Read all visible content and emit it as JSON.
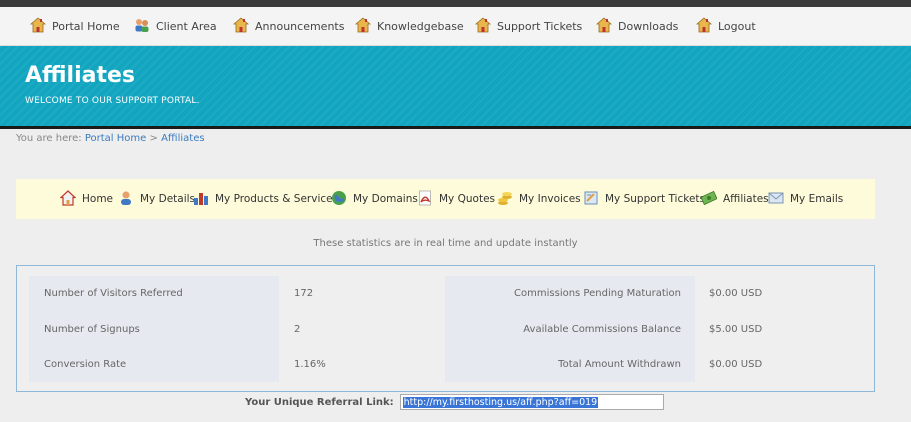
{
  "topnav": [
    {
      "label": "Portal Home",
      "icon": "house-icon"
    },
    {
      "label": "Client Area",
      "icon": "users-icon"
    },
    {
      "label": "Announcements",
      "icon": "house-icon"
    },
    {
      "label": "Knowledgebase",
      "icon": "house-icon"
    },
    {
      "label": "Support Tickets",
      "icon": "house-icon"
    },
    {
      "label": "Downloads",
      "icon": "house-icon"
    },
    {
      "label": "Logout",
      "icon": "house-icon"
    }
  ],
  "banner": {
    "title": "Affiliates",
    "subtitle": "WELCOME TO OUR SUPPORT PORTAL."
  },
  "breadcrumb": {
    "prefix": "You are here:",
    "home": "Portal Home",
    "separator": ">",
    "current": "Affiliates"
  },
  "menu": [
    {
      "label": "Home",
      "icon": "home-icon"
    },
    {
      "label": "My Details",
      "icon": "person-icon"
    },
    {
      "label": "My Products & Services",
      "icon": "bar-chart-icon"
    },
    {
      "label": "My Domains",
      "icon": "globe-icon"
    },
    {
      "label": "My Quotes",
      "icon": "pdf-icon"
    },
    {
      "label": "My Invoices",
      "icon": "coins-icon"
    },
    {
      "label": "My Support Tickets",
      "icon": "ticket-icon"
    },
    {
      "label": "Affiliates",
      "icon": "money-icon"
    },
    {
      "label": "My Emails",
      "icon": "envelope-icon"
    }
  ],
  "notice": "These statistics are in real time and update instantly",
  "stats": {
    "left": [
      {
        "label": "Number of Visitors Referred",
        "value": "172"
      },
      {
        "label": "Number of Signups",
        "value": "2"
      },
      {
        "label": "Conversion Rate",
        "value": "1.16%"
      }
    ],
    "right": [
      {
        "label": "Commissions Pending Maturation",
        "value": "$0.00 USD"
      },
      {
        "label": "Available Commissions Balance",
        "value": "$5.00 USD"
      },
      {
        "label": "Total Amount Withdrawn",
        "value": "$0.00 USD"
      }
    ]
  },
  "referral": {
    "label": "Your Unique Referral Link:",
    "link": "http://my.firsthosting.us/aff.php?aff=019"
  },
  "colors": {
    "banner": "#12a5c0",
    "menubar": "#fdfbd9",
    "link": "#3b7bbf"
  }
}
